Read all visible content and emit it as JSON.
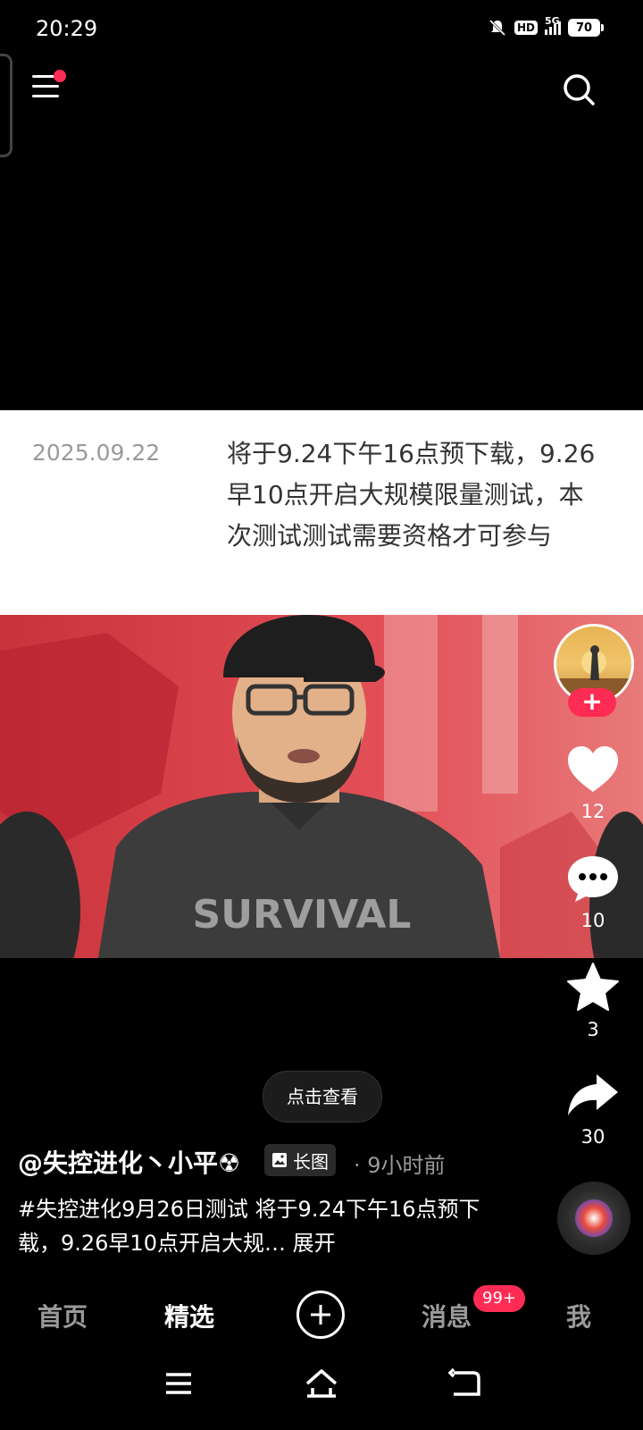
{
  "status_bar": {
    "time": "20:29",
    "network": "5G",
    "hd_label": "HD",
    "battery": "70",
    "icons": [
      "mute-icon",
      "hd-icon",
      "signal-icon",
      "battery-icon"
    ]
  },
  "top_bar": {
    "icons": [
      "menu-icon",
      "search-icon"
    ],
    "notification_dot_color": "#fe2c55"
  },
  "post_card": {
    "date": "2025.09.22",
    "text": "将于9.24下午16点预下载，9.26早10点开启大规模限量测试，本次测试测试需要资格才可参与"
  },
  "photo": {
    "shirt_text": "SURVIVAL"
  },
  "actions": {
    "like_count": "12",
    "comment_count": "10",
    "favorite_count": "3",
    "share_count": "30",
    "follow_symbol": "+"
  },
  "view_button": "点击查看",
  "author": {
    "name": "@失控进化丶小平☢",
    "tag": "长图",
    "time_ago": "· 9小时前"
  },
  "caption": {
    "text": "#失控进化9月26日测试 将于9.24下午16点预下载，9.26早10点开启大规…",
    "expand": "展开"
  },
  "bottom_nav": {
    "home": "首页",
    "featured": "精选",
    "messages": "消息",
    "messages_badge": "99+",
    "me": "我"
  },
  "colors": {
    "accent": "#fe2c55",
    "background": "#000000"
  }
}
